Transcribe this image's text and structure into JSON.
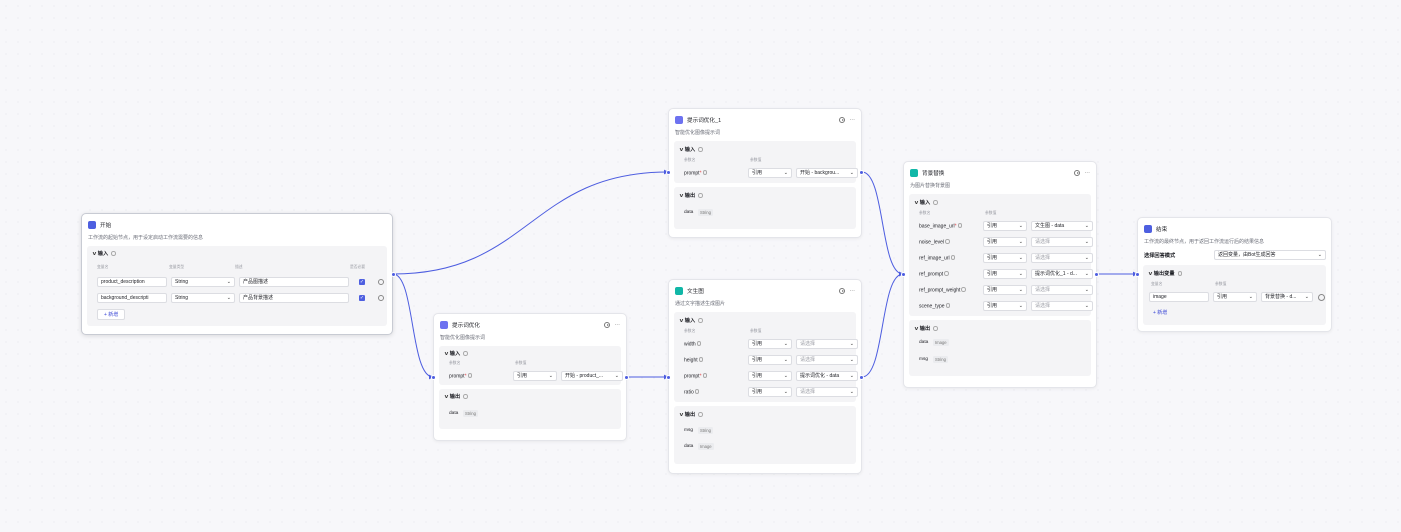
{
  "nodes": {
    "start": {
      "title": "开始",
      "desc": "工作流的起始节点，用于设定启动工作流需要的信息",
      "input_label": "输入",
      "col_name": "变量名",
      "col_type": "变量类型",
      "col_desc": "描述",
      "col_required": "是否必要",
      "rows": [
        {
          "name": "product_description",
          "type": "String",
          "desc": "产品图描述"
        },
        {
          "name": "background_descripti",
          "type": "String",
          "desc": "产品背景描述"
        }
      ],
      "add_label": "+ 新增"
    },
    "prompt_opt": {
      "title": "提示词优化",
      "desc": "智能优化图像提示词",
      "input_label": "输入",
      "col_name": "参数名",
      "col_value": "参数值",
      "param": "prompt",
      "ref": "引用",
      "value": "开始 - product_...",
      "output_label": "输出",
      "out_name": "data",
      "out_type": "String"
    },
    "prompt_opt1": {
      "title": "提示词优化_1",
      "desc": "智能优化图像提示词",
      "input_label": "输入",
      "col_name": "参数名",
      "col_value": "参数值",
      "param": "prompt",
      "ref": "引用",
      "value": "开始 - backgrou...",
      "output_label": "输出",
      "out_name": "data",
      "out_type": "String"
    },
    "text2img": {
      "title": "文生图",
      "desc": "通过文字描述生成图片",
      "input_label": "输入",
      "col_name": "参数名",
      "col_value": "参数值",
      "params": [
        {
          "name": "width",
          "ref": "引用",
          "value": "请选择"
        },
        {
          "name": "height",
          "ref": "引用",
          "value": "请选择"
        },
        {
          "name": "prompt",
          "ref": "引用",
          "value": "提示词优化 - data"
        },
        {
          "name": "ratio",
          "ref": "引用",
          "value": "请选择"
        }
      ],
      "output_label": "输出",
      "outputs": [
        {
          "name": "msg",
          "type": "String"
        },
        {
          "name": "data",
          "type": "Image"
        }
      ]
    },
    "bgreplace": {
      "title": "背景替换",
      "desc": "为图片替换背景图",
      "input_label": "输入",
      "col_name": "参数名",
      "col_value": "参数值",
      "params": [
        {
          "name": "base_image_url",
          "ref": "引用",
          "value": "文生图 - data"
        },
        {
          "name": "noise_level",
          "ref": "引用",
          "value": "请选择"
        },
        {
          "name": "ref_image_url",
          "ref": "引用",
          "value": "请选择"
        },
        {
          "name": "ref_prompt",
          "ref": "引用",
          "value": "提示词优化_1 - d..."
        },
        {
          "name": "ref_prompt_weight",
          "ref": "引用",
          "value": "请选择"
        },
        {
          "name": "scene_type",
          "ref": "引用",
          "value": "请选择"
        }
      ],
      "output_label": "输出",
      "outputs": [
        {
          "name": "data",
          "type": "Image"
        },
        {
          "name": "msg",
          "type": "String"
        }
      ]
    },
    "end": {
      "title": "结束",
      "desc": "工作流的最终节点，用于返回工作流运行后的结果信息",
      "mode_label": "选择回答模式",
      "mode_value": "返回变量，由Bot生成回答",
      "output_label": "输出变量",
      "col_name": "变量名",
      "col_value": "参数值",
      "var_name": "image",
      "ref": "引用",
      "value": "背景替换 - d...",
      "add_label": "+ 新增"
    }
  },
  "colors": {
    "accent": "#4d5de0",
    "edge": "#4d5de0"
  }
}
